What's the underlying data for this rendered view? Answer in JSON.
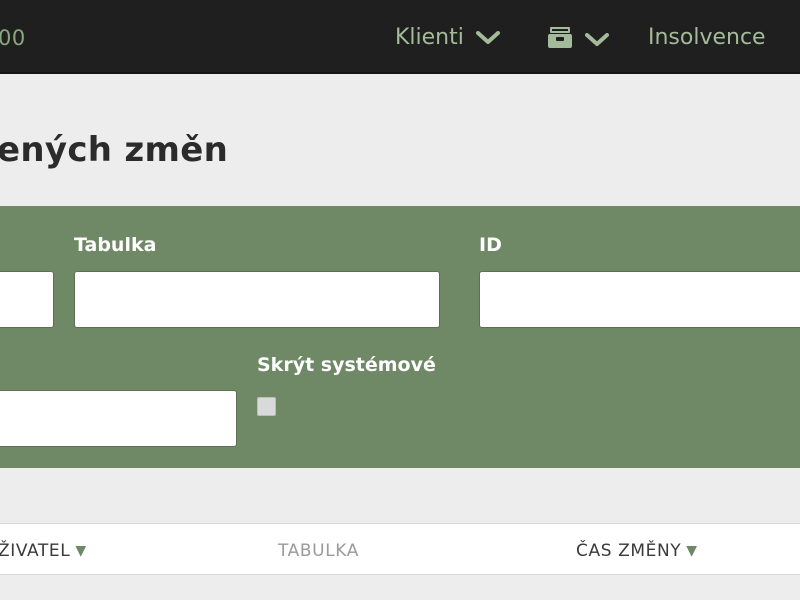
{
  "topbar": {
    "left_fragment": "00",
    "menu": [
      {
        "label": "Klienti",
        "icon": "chevron-down-icon"
      },
      {
        "label": "",
        "icon": "archive-box-icon"
      },
      {
        "label": "Insolvence"
      }
    ]
  },
  "page": {
    "title": "ených změn"
  },
  "filters": {
    "tabulka_label": "Tabulka",
    "tabulka_value": "",
    "id_label": "ID",
    "id_value": "",
    "first_value": "",
    "second_value": "",
    "hide_system_label": "Skrýt systémové",
    "hide_system_checked": false
  },
  "table": {
    "columns": [
      {
        "label": "ŽIVATEL",
        "sort": "desc"
      },
      {
        "label": "TABULKA"
      },
      {
        "label": "ČAS ZMĚNY",
        "sort": "desc"
      }
    ],
    "sort_glyph": "▼"
  },
  "colors": {
    "accent_green": "#6f8865",
    "topbar_bg": "#1f1f1f",
    "nav_text": "#a3bb98",
    "page_bg": "#ededed"
  }
}
